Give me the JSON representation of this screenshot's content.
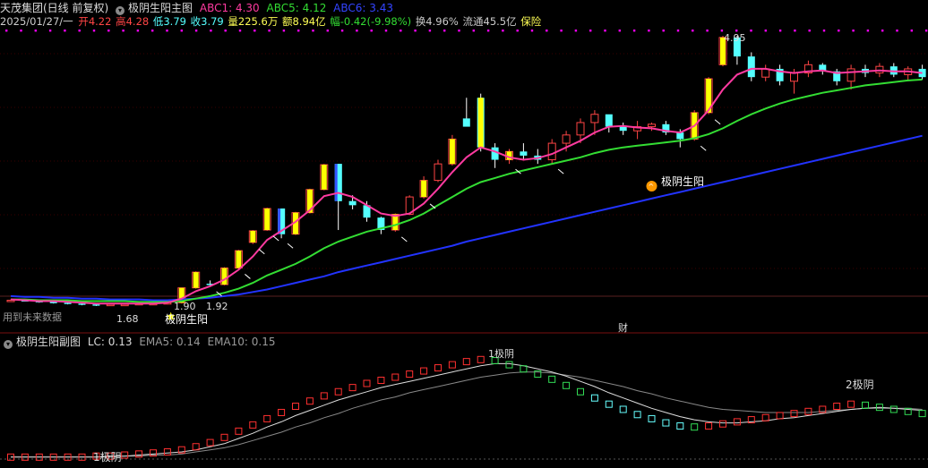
{
  "header": {
    "stock": "天茂集团(日线 前复权)",
    "indicator": "极阴生阳主图",
    "abc1_label": "ABC1: 4.30",
    "abc5_label": "ABC5: 4.12",
    "abc6_label": "ABC6: 3.43",
    "date": "2025/01/27/一",
    "open": "开4.22",
    "high": "高4.28",
    "low": "低3.79",
    "close": "收3.79",
    "volume": "量225.6万",
    "amount": "额8.94亿",
    "change": "幅-0.42(-9.98%)",
    "turnover": "换4.96%",
    "float": "流通45.5亿",
    "sector": "保险"
  },
  "colors": {
    "bg": "#000000",
    "up": "#ff4545",
    "down": "#54ffff",
    "abc1": "#ff3aa0",
    "abc5": "#33dd33",
    "abc6": "#2233ff",
    "signal": "#ffff00",
    "magenta_dots": "#ff00ff",
    "text": "#c8c8c8"
  },
  "annotations": {
    "peak_price": "4.95",
    "low_price": "1.68",
    "price_190": "1.90",
    "price_192": "1.92",
    "signal_1": "极阴生阳",
    "signal_2": "极阴生阳",
    "future_data": "用到未来数据",
    "cai": "财"
  },
  "sub": {
    "title": "极阴生阳副图",
    "lc": "LC: 0.13",
    "ema5": "EMA5: 0.14",
    "ema10": "EMA10: 0.15",
    "label_1": "1极阴",
    "label_2": "2极阴",
    "label_3": "1极阴"
  },
  "chart_data": {
    "type": "candlestick",
    "candles": [
      [
        1.74,
        1.76,
        1.73,
        1.75
      ],
      [
        1.75,
        1.76,
        1.74,
        1.74
      ],
      [
        1.74,
        1.75,
        1.72,
        1.73
      ],
      [
        1.73,
        1.74,
        1.71,
        1.72
      ],
      [
        1.72,
        1.73,
        1.7,
        1.71
      ],
      [
        1.71,
        1.72,
        1.69,
        1.7
      ],
      [
        1.7,
        1.71,
        1.68,
        1.69
      ],
      [
        1.69,
        1.7,
        1.68,
        1.7
      ],
      [
        1.7,
        1.71,
        1.69,
        1.7
      ],
      [
        1.7,
        1.71,
        1.69,
        1.71
      ],
      [
        1.71,
        1.72,
        1.7,
        1.71
      ],
      [
        1.71,
        1.72,
        1.7,
        1.72
      ],
      [
        1.72,
        1.9,
        1.71,
        1.9
      ],
      [
        1.9,
        2.1,
        1.89,
        2.09
      ],
      [
        1.95,
        1.99,
        1.92,
        1.94
      ],
      [
        1.94,
        2.15,
        1.93,
        2.14
      ],
      [
        2.14,
        2.36,
        2.13,
        2.35
      ],
      [
        2.45,
        2.6,
        2.43,
        2.59
      ],
      [
        2.6,
        2.87,
        2.59,
        2.86
      ],
      [
        2.86,
        2.55,
        2.5,
        2.55
      ],
      [
        2.55,
        2.82,
        2.54,
        2.81
      ],
      [
        2.81,
        3.1,
        2.8,
        3.09
      ],
      [
        3.09,
        3.4,
        3.08,
        3.39
      ],
      [
        3.4,
        3.4,
        2.6,
        2.95
      ],
      [
        2.95,
        3.02,
        2.85,
        2.9
      ],
      [
        2.9,
        2.95,
        2.7,
        2.75
      ],
      [
        2.75,
        2.76,
        2.55,
        2.6
      ],
      [
        2.6,
        2.8,
        2.58,
        2.79
      ],
      [
        2.79,
        3.02,
        2.78,
        3.0
      ],
      [
        3.0,
        3.25,
        2.98,
        3.2
      ],
      [
        3.2,
        3.45,
        3.18,
        3.4
      ],
      [
        3.4,
        3.75,
        3.38,
        3.7
      ],
      [
        3.95,
        4.2,
        3.9,
        3.85
      ],
      [
        4.2,
        4.25,
        3.55,
        3.6
      ],
      [
        3.6,
        3.65,
        3.35,
        3.45
      ],
      [
        3.45,
        3.58,
        3.4,
        3.55
      ],
      [
        3.55,
        3.65,
        3.45,
        3.5
      ],
      [
        3.5,
        3.58,
        3.4,
        3.45
      ],
      [
        3.45,
        3.7,
        3.4,
        3.65
      ],
      [
        3.65,
        3.8,
        3.55,
        3.75
      ],
      [
        3.75,
        3.95,
        3.65,
        3.9
      ],
      [
        3.9,
        4.05,
        3.75,
        4.0
      ],
      [
        4.0,
        3.95,
        3.78,
        3.85
      ],
      [
        3.85,
        3.9,
        3.75,
        3.8
      ],
      [
        3.8,
        3.92,
        3.7,
        3.85
      ],
      [
        3.85,
        3.9,
        3.8,
        3.88
      ],
      [
        3.88,
        3.92,
        3.75,
        3.78
      ],
      [
        3.78,
        3.82,
        3.6,
        3.7
      ],
      [
        3.7,
        4.05,
        3.68,
        4.02
      ],
      [
        4.02,
        4.45,
        4.0,
        4.43
      ],
      [
        4.6,
        4.95,
        4.58,
        4.93
      ],
      [
        4.93,
        4.95,
        4.6,
        4.7
      ],
      [
        4.7,
        4.75,
        4.4,
        4.45
      ],
      [
        4.45,
        4.6,
        4.4,
        4.55
      ],
      [
        4.55,
        4.6,
        4.35,
        4.4
      ],
      [
        4.4,
        4.55,
        4.25,
        4.5
      ],
      [
        4.5,
        4.65,
        4.45,
        4.6
      ],
      [
        4.6,
        4.62,
        4.48,
        4.52
      ],
      [
        4.52,
        4.55,
        4.35,
        4.4
      ],
      [
        4.4,
        4.6,
        4.3,
        4.55
      ],
      [
        4.55,
        4.6,
        4.45,
        4.5
      ],
      [
        4.5,
        4.62,
        4.45,
        4.58
      ],
      [
        4.58,
        4.62,
        4.45,
        4.48
      ],
      [
        4.48,
        4.58,
        4.4,
        4.55
      ],
      [
        4.55,
        4.6,
        4.42,
        4.45
      ]
    ],
    "abc1": [
      1.76,
      1.75,
      1.74,
      1.74,
      1.73,
      1.72,
      1.71,
      1.71,
      1.71,
      1.71,
      1.71,
      1.72,
      1.77,
      1.86,
      1.92,
      2.0,
      2.12,
      2.28,
      2.48,
      2.59,
      2.7,
      2.84,
      3.01,
      3.05,
      3.0,
      2.9,
      2.8,
      2.77,
      2.8,
      2.92,
      3.1,
      3.3,
      3.48,
      3.6,
      3.55,
      3.48,
      3.45,
      3.47,
      3.52,
      3.6,
      3.68,
      3.78,
      3.85,
      3.86,
      3.84,
      3.83,
      3.8,
      3.78,
      3.86,
      4.05,
      4.3,
      4.48,
      4.55,
      4.55,
      4.52,
      4.5,
      4.52,
      4.53,
      4.5,
      4.51,
      4.52,
      4.53,
      4.52,
      4.52,
      4.5
    ],
    "abc5": [
      1.76,
      1.76,
      1.75,
      1.75,
      1.75,
      1.74,
      1.74,
      1.74,
      1.74,
      1.73,
      1.73,
      1.73,
      1.74,
      1.77,
      1.8,
      1.84,
      1.89,
      1.96,
      2.05,
      2.12,
      2.19,
      2.28,
      2.38,
      2.46,
      2.52,
      2.58,
      2.62,
      2.66,
      2.72,
      2.8,
      2.9,
      3.0,
      3.1,
      3.18,
      3.23,
      3.28,
      3.32,
      3.36,
      3.4,
      3.44,
      3.48,
      3.53,
      3.57,
      3.6,
      3.62,
      3.64,
      3.66,
      3.68,
      3.71,
      3.76,
      3.83,
      3.92,
      4.0,
      4.07,
      4.13,
      4.18,
      4.22,
      4.26,
      4.29,
      4.32,
      4.35,
      4.37,
      4.39,
      4.41,
      4.42
    ],
    "abc6": [
      1.8,
      1.79,
      1.79,
      1.78,
      1.78,
      1.77,
      1.77,
      1.76,
      1.76,
      1.76,
      1.75,
      1.75,
      1.76,
      1.77,
      1.78,
      1.8,
      1.82,
      1.85,
      1.88,
      1.92,
      1.96,
      2.0,
      2.04,
      2.09,
      2.13,
      2.17,
      2.21,
      2.25,
      2.29,
      2.33,
      2.37,
      2.41,
      2.46,
      2.5,
      2.54,
      2.58,
      2.62,
      2.66,
      2.7,
      2.74,
      2.78,
      2.82,
      2.86,
      2.9,
      2.94,
      2.98,
      3.02,
      3.06,
      3.1,
      3.14,
      3.18,
      3.22,
      3.26,
      3.3,
      3.34,
      3.38,
      3.42,
      3.46,
      3.5,
      3.54,
      3.58,
      3.62,
      3.66,
      3.7,
      3.74
    ],
    "lc": [
      0.01,
      0.01,
      0.01,
      0.01,
      0.01,
      0.01,
      0.02,
      0.02,
      0.03,
      0.04,
      0.05,
      0.06,
      0.08,
      0.11,
      0.15,
      0.2,
      0.26,
      0.32,
      0.38,
      0.44,
      0.5,
      0.55,
      0.6,
      0.64,
      0.68,
      0.72,
      0.75,
      0.78,
      0.81,
      0.84,
      0.87,
      0.9,
      0.93,
      0.95,
      0.94,
      0.9,
      0.86,
      0.81,
      0.76,
      0.7,
      0.64,
      0.58,
      0.52,
      0.47,
      0.42,
      0.38,
      0.34,
      0.31,
      0.3,
      0.31,
      0.33,
      0.35,
      0.37,
      0.39,
      0.41,
      0.43,
      0.45,
      0.47,
      0.5,
      0.52,
      0.51,
      0.49,
      0.47,
      0.45,
      0.43
    ],
    "ema5": [
      0.01,
      0.01,
      0.01,
      0.01,
      0.01,
      0.01,
      0.01,
      0.02,
      0.02,
      0.03,
      0.04,
      0.05,
      0.06,
      0.08,
      0.11,
      0.14,
      0.19,
      0.24,
      0.3,
      0.35,
      0.41,
      0.46,
      0.51,
      0.56,
      0.6,
      0.64,
      0.68,
      0.71,
      0.74,
      0.77,
      0.8,
      0.83,
      0.86,
      0.89,
      0.91,
      0.91,
      0.89,
      0.86,
      0.83,
      0.79,
      0.74,
      0.69,
      0.63,
      0.58,
      0.53,
      0.48,
      0.44,
      0.4,
      0.37,
      0.35,
      0.34,
      0.34,
      0.35,
      0.36,
      0.38,
      0.39,
      0.41,
      0.43,
      0.45,
      0.47,
      0.48,
      0.49,
      0.48,
      0.47,
      0.46
    ],
    "ema10": [
      0.01,
      0.01,
      0.01,
      0.01,
      0.01,
      0.01,
      0.01,
      0.01,
      0.02,
      0.02,
      0.03,
      0.03,
      0.04,
      0.06,
      0.08,
      0.1,
      0.13,
      0.17,
      0.21,
      0.25,
      0.3,
      0.34,
      0.39,
      0.43,
      0.48,
      0.52,
      0.56,
      0.59,
      0.63,
      0.66,
      0.69,
      0.72,
      0.75,
      0.78,
      0.8,
      0.82,
      0.83,
      0.83,
      0.82,
      0.8,
      0.78,
      0.75,
      0.72,
      0.69,
      0.65,
      0.62,
      0.58,
      0.55,
      0.52,
      0.49,
      0.47,
      0.46,
      0.45,
      0.44,
      0.44,
      0.44,
      0.44,
      0.45,
      0.46,
      0.47,
      0.48,
      0.48,
      0.48,
      0.48,
      0.47
    ]
  }
}
